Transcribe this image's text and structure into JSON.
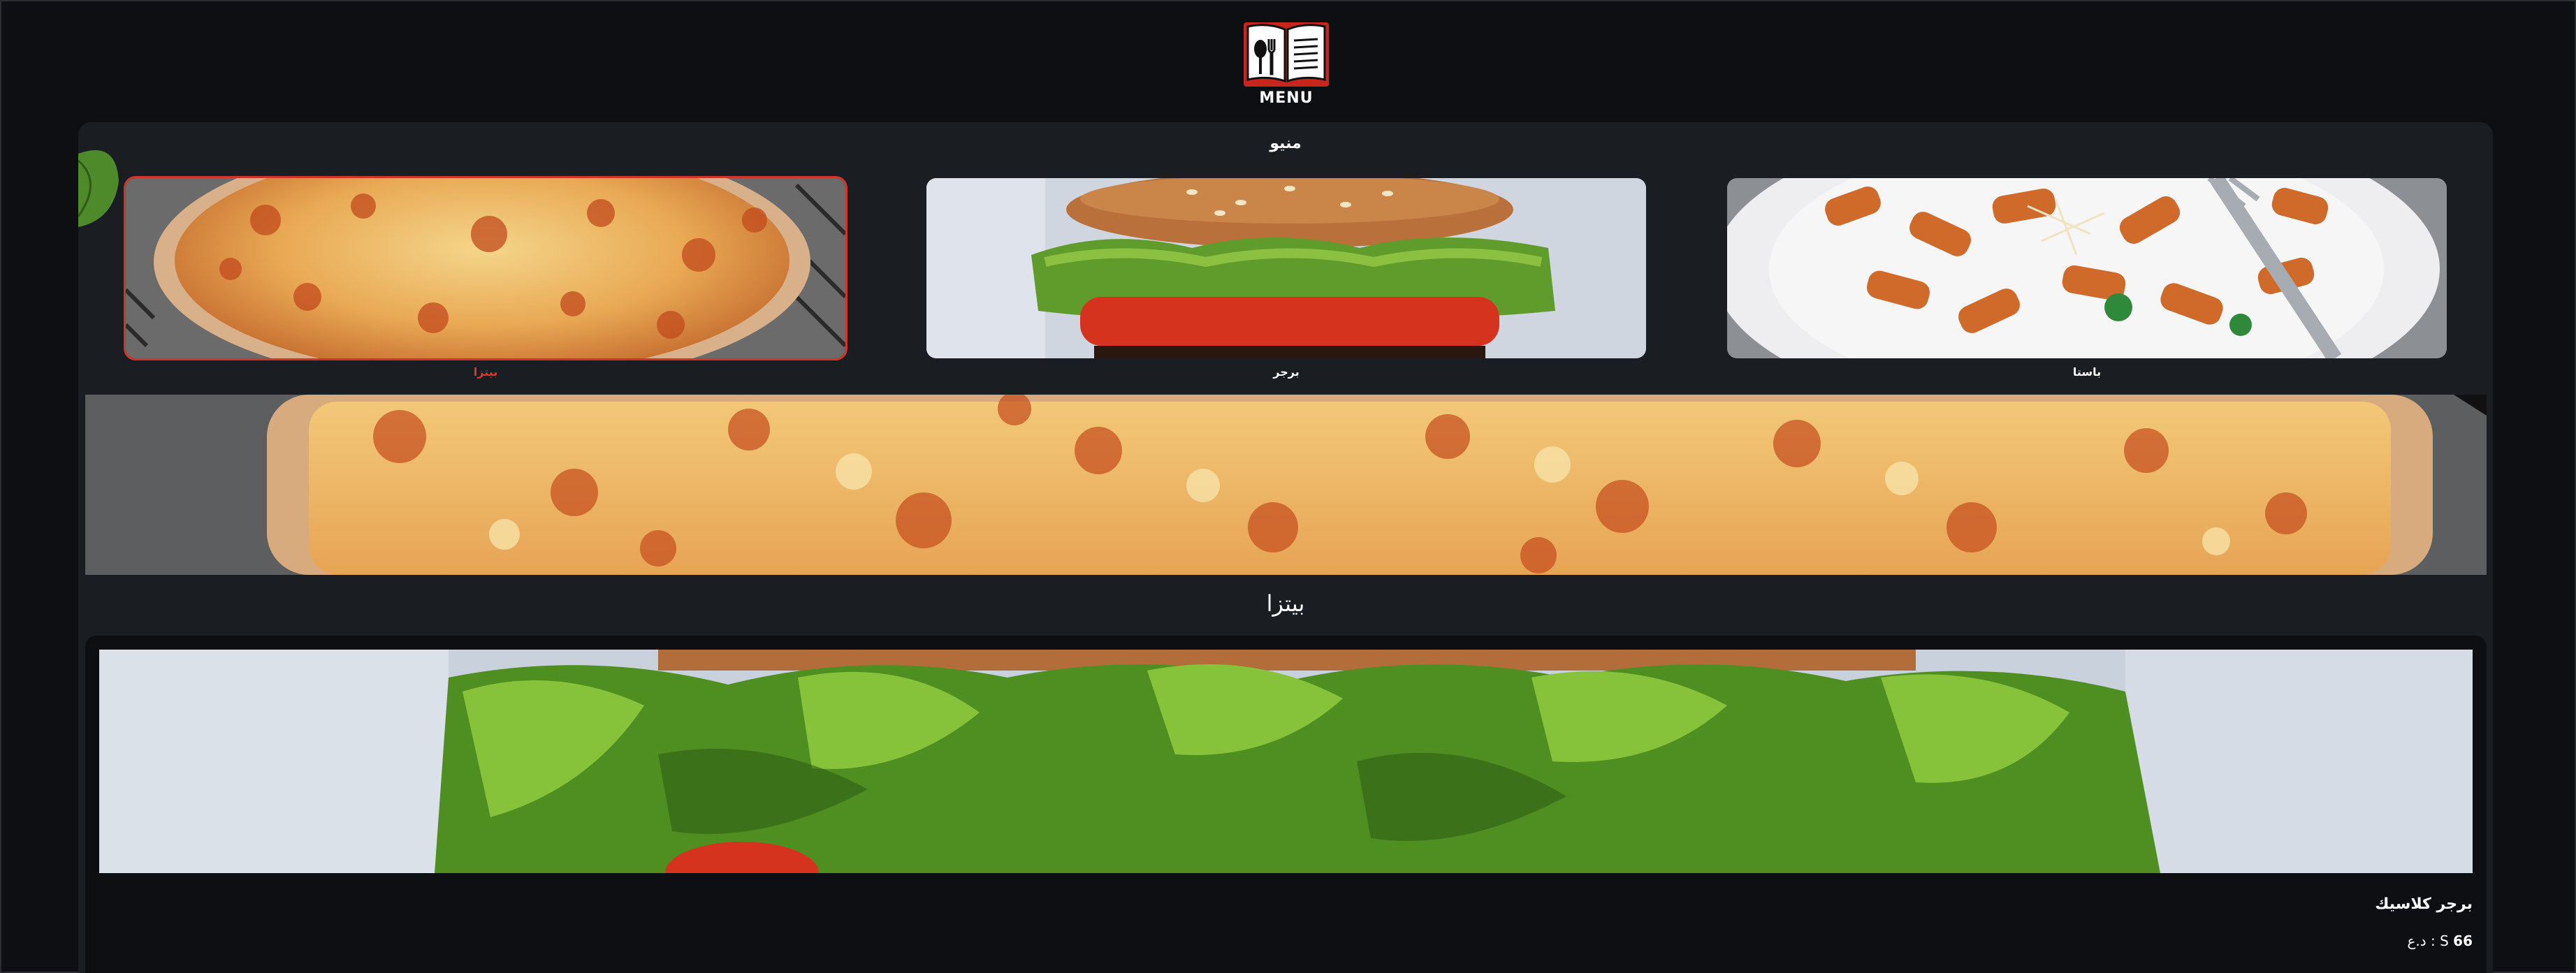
{
  "header": {
    "logo_icon": "menu-book-icon",
    "logo_text": "MENU"
  },
  "panel": {
    "title": "منيو"
  },
  "categories": [
    {
      "label": "بيتزا",
      "icon": "pizza-image",
      "selected": true
    },
    {
      "label": "برجر",
      "icon": "burger-image",
      "selected": false
    },
    {
      "label": "باستا",
      "icon": "pasta-image",
      "selected": false
    }
  ],
  "section": {
    "title": "بيتزا"
  },
  "item": {
    "name": "برجر كلاسيك",
    "price_value": "66",
    "price_suffix": "د.ع : S"
  },
  "colors": {
    "background": "#0d0f12",
    "panel": "#1a1d22",
    "accent": "#e0372c"
  }
}
